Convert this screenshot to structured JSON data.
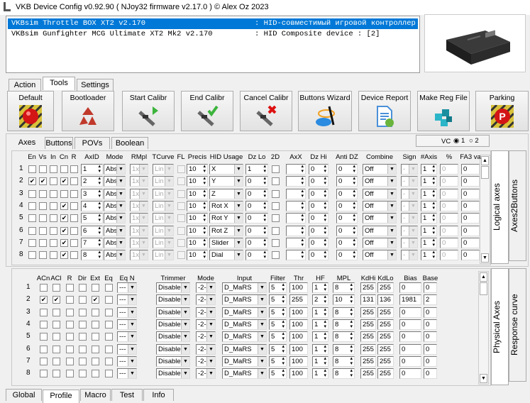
{
  "window": {
    "title": "VKB Device Config v0.92.90 ( NJoy32 firmware v2.17.0 ) © Alex Oz 2023"
  },
  "devices": [
    {
      "name": "VKBsim Throttle BOX XT2 v2.170",
      "hid": ": HID-совместимый игровой контроллер",
      "selected": true
    },
    {
      "name": "VKBsim Gunfighter MCG Ultimate XT2 Mk2 v2.170",
      "hid": ": HID Composite device : [2]",
      "selected": false
    }
  ],
  "top_tabs": [
    "Action",
    "Tools",
    "Settings"
  ],
  "top_tab_selected": "Tools",
  "toolbar": [
    {
      "label": "Default",
      "icon": "red-button-icon"
    },
    {
      "label": "Bootloader",
      "icon": "recycle-icon"
    },
    {
      "label": "Start Calibr",
      "icon": "caliper-play-icon"
    },
    {
      "label": "End Calibr",
      "icon": "caliper-check-icon"
    },
    {
      "label": "Cancel Calibr",
      "icon": "caliper-cancel-icon"
    },
    {
      "label": "Buttons Wizard",
      "icon": "magic-wand-icon"
    },
    {
      "label": "Device Report",
      "icon": "report-document-icon"
    },
    {
      "label": "Make Reg File",
      "icon": "registry-cubes-icon"
    },
    {
      "label": "Parking",
      "icon": "parking-button-icon"
    }
  ],
  "sub_tabs": [
    "Axes",
    "Buttons",
    "POVs",
    "Boolean"
  ],
  "sub_tab_selected": "Axes",
  "vc": {
    "label": "VC",
    "options": [
      "1",
      "2"
    ],
    "selected": "1"
  },
  "logical": {
    "headers": {
      "en": "En",
      "vs": "Vs",
      "in": "In",
      "cn": "Cn",
      "r": "R",
      "axid": "AxID",
      "mode": "Mode",
      "rmpl": "RMpl",
      "tcurve": "TCurve",
      "fl": "FL",
      "precis": "Precis",
      "hid": "HID Usage",
      "dzlo": "Dz Lo",
      "d2": "2D",
      "axx": "AxX",
      "dzhi": "Dz Hi",
      "antidz": "Anti DZ",
      "combine": "Combine",
      "sign": "Sign",
      "naxis": "#Axis",
      "pct": "%",
      "fa3": "FA3 va"
    },
    "rows": [
      {
        "n": "1",
        "en": false,
        "vs": false,
        "in": false,
        "cn": false,
        "r": false,
        "axid": "1",
        "mode": "Abs",
        "rmpl": "1x",
        "tcurve": "Lin",
        "fl": false,
        "precis": "10",
        "hid": "X",
        "dzlo": "1",
        "d2": false,
        "axx": "",
        "dzhi": "0",
        "antidz": "0",
        "combine": "Off",
        "sign": "-",
        "naxis": "1",
        "pct": "0",
        "fa3": "0"
      },
      {
        "n": "2",
        "en": true,
        "vs": true,
        "in": false,
        "cn": true,
        "r": false,
        "axid": "2",
        "mode": "Abs",
        "rmpl": "1x",
        "tcurve": "Lin",
        "fl": false,
        "precis": "10",
        "hid": "Y",
        "dzlo": "0",
        "d2": false,
        "axx": "",
        "dzhi": "0",
        "antidz": "0",
        "combine": "Off",
        "sign": "-",
        "naxis": "1",
        "pct": "0",
        "fa3": "0"
      },
      {
        "n": "3",
        "en": false,
        "vs": false,
        "in": false,
        "cn": false,
        "r": false,
        "axid": "3",
        "mode": "Abs",
        "rmpl": "1x",
        "tcurve": "Lin",
        "fl": false,
        "precis": "10",
        "hid": "Z",
        "dzlo": "0",
        "d2": false,
        "axx": "",
        "dzhi": "0",
        "antidz": "0",
        "combine": "Off",
        "sign": "-",
        "naxis": "1",
        "pct": "0",
        "fa3": "0"
      },
      {
        "n": "4",
        "en": false,
        "vs": false,
        "in": false,
        "cn": true,
        "r": false,
        "axid": "4",
        "mode": "Abs",
        "rmpl": "1x",
        "tcurve": "Lin",
        "fl": false,
        "precis": "10",
        "hid": "Rot X",
        "dzlo": "0",
        "d2": false,
        "axx": "",
        "dzhi": "0",
        "antidz": "0",
        "combine": "Off",
        "sign": "-",
        "naxis": "1",
        "pct": "0",
        "fa3": "0"
      },
      {
        "n": "5",
        "en": false,
        "vs": false,
        "in": false,
        "cn": true,
        "r": false,
        "axid": "5",
        "mode": "Abs",
        "rmpl": "1x",
        "tcurve": "Lin",
        "fl": false,
        "precis": "10",
        "hid": "Rot Y",
        "dzlo": "0",
        "d2": false,
        "axx": "",
        "dzhi": "0",
        "antidz": "0",
        "combine": "Off",
        "sign": "-",
        "naxis": "1",
        "pct": "0",
        "fa3": "0"
      },
      {
        "n": "6",
        "en": false,
        "vs": false,
        "in": false,
        "cn": true,
        "r": false,
        "axid": "6",
        "mode": "Abs",
        "rmpl": "1x",
        "tcurve": "Lin",
        "fl": false,
        "precis": "10",
        "hid": "Rot Z",
        "dzlo": "0",
        "d2": false,
        "axx": "",
        "dzhi": "0",
        "antidz": "0",
        "combine": "Off",
        "sign": "-",
        "naxis": "1",
        "pct": "0",
        "fa3": "0"
      },
      {
        "n": "7",
        "en": false,
        "vs": false,
        "in": false,
        "cn": true,
        "r": false,
        "axid": "7",
        "mode": "Abs",
        "rmpl": "1x",
        "tcurve": "Lin",
        "fl": false,
        "precis": "10",
        "hid": "Slider",
        "dzlo": "0",
        "d2": false,
        "axx": "",
        "dzhi": "0",
        "antidz": "0",
        "combine": "Off",
        "sign": "-",
        "naxis": "1",
        "pct": "0",
        "fa3": "0"
      },
      {
        "n": "8",
        "en": false,
        "vs": false,
        "in": false,
        "cn": true,
        "r": false,
        "axid": "8",
        "mode": "Abs",
        "rmpl": "1x",
        "tcurve": "Lin",
        "fl": false,
        "precis": "10",
        "hid": "Dial",
        "dzlo": "0",
        "d2": false,
        "axx": "",
        "dzhi": "0",
        "antidz": "0",
        "combine": "Off",
        "sign": "-",
        "naxis": "1",
        "pct": "0",
        "fa3": "0"
      }
    ],
    "side_tabs": [
      "Logical axes",
      "Axes2Buttons"
    ]
  },
  "physical": {
    "headers": {
      "acn": "ACn",
      "acl": "ACl",
      "r": "R",
      "dir": "Dir",
      "ext": "Ext",
      "eq": "Eq",
      "eqn": "Eq N",
      "trimmer": "Trimmer",
      "mode": "Mode",
      "input": "Input",
      "filter": "Filter",
      "thr": "Thr",
      "hf": "HF",
      "mpl": "MPL",
      "kdhi": "KdHi",
      "kdlo": "KdLo",
      "bias": "Bias",
      "base": "Base"
    },
    "rows": [
      {
        "n": "1",
        "acn": false,
        "acl": false,
        "r": false,
        "dir": false,
        "ext": false,
        "eq": false,
        "eqn": "---",
        "trimmer": "Disable",
        "mode": "-2-",
        "input": "D_MaRS",
        "filter": "5",
        "thr": "100",
        "hf": "1",
        "mpl": "8",
        "kdhi": "255",
        "kdlo": "255",
        "bias": "0",
        "base": "0"
      },
      {
        "n": "2",
        "acn": true,
        "acl": true,
        "r": false,
        "dir": false,
        "ext": true,
        "eq": false,
        "eqn": "---",
        "trimmer": "Disable",
        "mode": "-2-",
        "input": "D_MaRS",
        "filter": "5",
        "thr": "255",
        "hf": "2",
        "mpl": "10",
        "kdhi": "131",
        "kdlo": "136",
        "bias": "1981",
        "base": "2"
      },
      {
        "n": "3",
        "acn": false,
        "acl": false,
        "r": false,
        "dir": false,
        "ext": false,
        "eq": false,
        "eqn": "---",
        "trimmer": "Disable",
        "mode": "-2-",
        "input": "D_MaRS",
        "filter": "5",
        "thr": "100",
        "hf": "1",
        "mpl": "8",
        "kdhi": "255",
        "kdlo": "255",
        "bias": "0",
        "base": "0"
      },
      {
        "n": "4",
        "acn": false,
        "acl": false,
        "r": false,
        "dir": false,
        "ext": false,
        "eq": false,
        "eqn": "---",
        "trimmer": "Disable",
        "mode": "-2-",
        "input": "D_MaRS",
        "filter": "5",
        "thr": "100",
        "hf": "1",
        "mpl": "8",
        "kdhi": "255",
        "kdlo": "255",
        "bias": "0",
        "base": "0"
      },
      {
        "n": "5",
        "acn": false,
        "acl": false,
        "r": false,
        "dir": false,
        "ext": false,
        "eq": false,
        "eqn": "---",
        "trimmer": "Disable",
        "mode": "-2-",
        "input": "D_MaRS",
        "filter": "5",
        "thr": "100",
        "hf": "1",
        "mpl": "8",
        "kdhi": "255",
        "kdlo": "255",
        "bias": "0",
        "base": "0"
      },
      {
        "n": "6",
        "acn": false,
        "acl": false,
        "r": false,
        "dir": false,
        "ext": false,
        "eq": false,
        "eqn": "---",
        "trimmer": "Disable",
        "mode": "-2-",
        "input": "D_MaRS",
        "filter": "5",
        "thr": "100",
        "hf": "1",
        "mpl": "8",
        "kdhi": "255",
        "kdlo": "255",
        "bias": "0",
        "base": "0"
      },
      {
        "n": "7",
        "acn": false,
        "acl": false,
        "r": false,
        "dir": false,
        "ext": false,
        "eq": false,
        "eqn": "---",
        "trimmer": "Disable",
        "mode": "-2-",
        "input": "D_MaRS",
        "filter": "5",
        "thr": "100",
        "hf": "1",
        "mpl": "8",
        "kdhi": "255",
        "kdlo": "255",
        "bias": "0",
        "base": "0"
      },
      {
        "n": "8",
        "acn": false,
        "acl": false,
        "r": false,
        "dir": false,
        "ext": false,
        "eq": false,
        "eqn": "---",
        "trimmer": "Disable",
        "mode": "-2-",
        "input": "D_MaRS",
        "filter": "5",
        "thr": "100",
        "hf": "1",
        "mpl": "8",
        "kdhi": "255",
        "kdlo": "255",
        "bias": "0",
        "base": "0"
      }
    ],
    "side_tabs": [
      "Physical Axes",
      "Response curve"
    ]
  },
  "bottom_tabs": [
    "Global",
    "Profile",
    "Macro",
    "Test",
    "Info"
  ],
  "bottom_tab_selected": "Profile",
  "colors": {
    "selection": "#0078d7",
    "window_bg": "#f0f0f0"
  }
}
